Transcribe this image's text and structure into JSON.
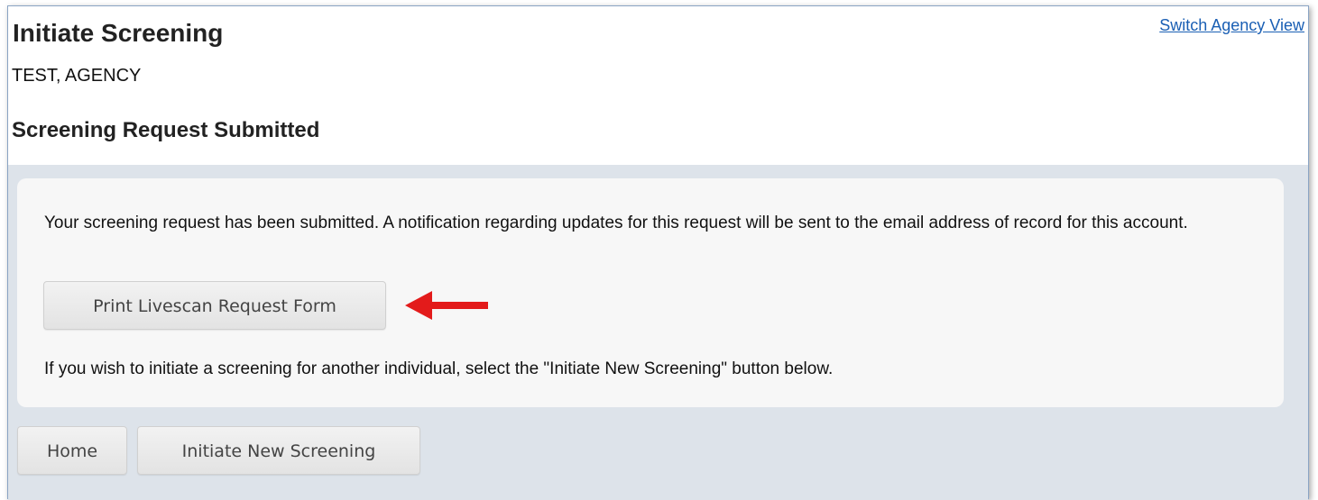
{
  "header": {
    "title": "Initiate Screening",
    "agency": "TEST, AGENCY",
    "switch_link": "Switch Agency View"
  },
  "section": {
    "title": "Screening Request Submitted"
  },
  "panel": {
    "message": "Your screening request has been submitted. A notification regarding updates for this request will be sent to the email address of record for this account.",
    "print_button": "Print Livescan Request Form",
    "instruction": "If you wish to initiate a screening for another individual, select the \"Initiate New Screening\" button below."
  },
  "actions": {
    "home_button": "Home",
    "new_screening_button": "Initiate New Screening"
  },
  "colors": {
    "link": "#1a5fb4",
    "arrow": "#e31b1b",
    "content_background": "#dde3ea"
  },
  "icons": {
    "annotation": "left-arrow-icon"
  }
}
